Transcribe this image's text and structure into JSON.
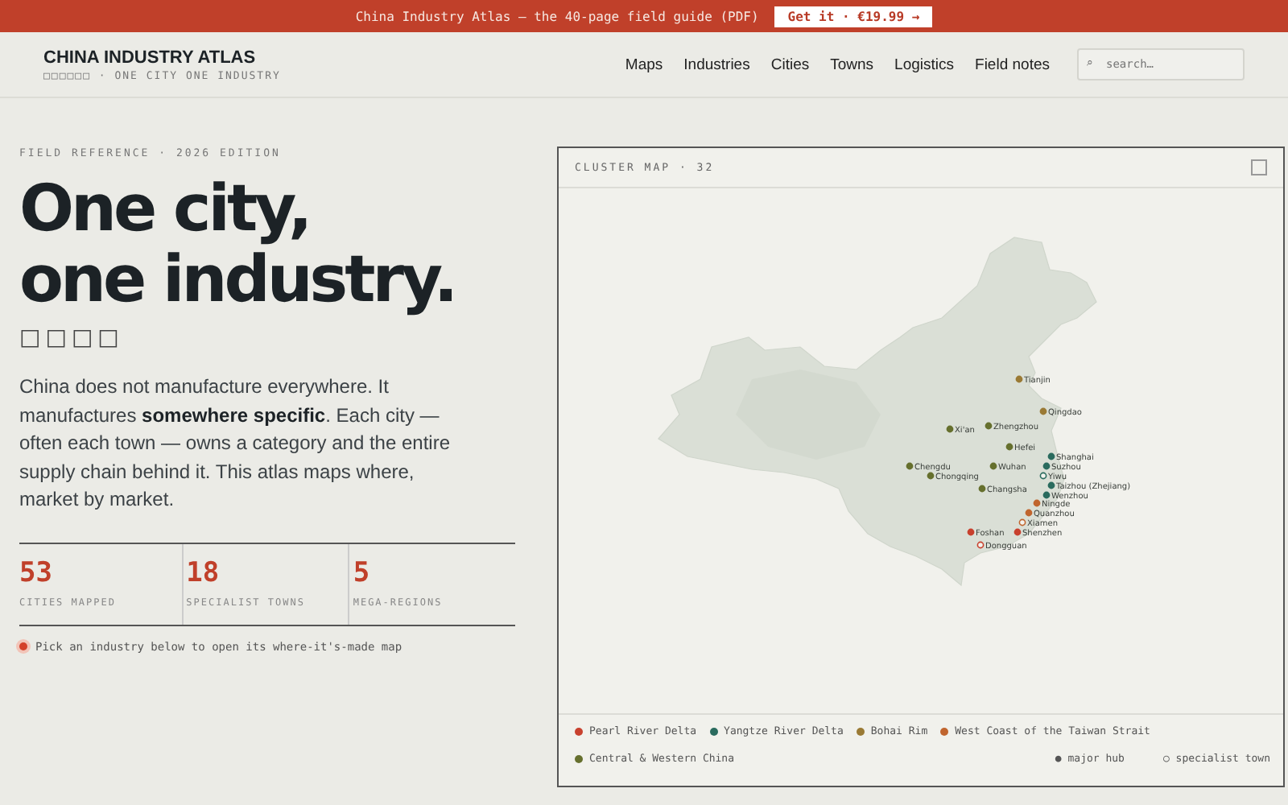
{
  "banner": {
    "text": "China Industry Atlas — the 40-page field guide (PDF)",
    "button": "Get it · €19.99 →"
  },
  "header": {
    "brand": "CHINA INDUSTRY ATLAS",
    "tagline": "□□□□□□ · ONE CITY ONE INDUSTRY",
    "nav": [
      "Maps",
      "Industries",
      "Cities",
      "Towns",
      "Logistics",
      "Field notes"
    ],
    "search": {
      "icon": "⌕",
      "placeholder": "search…"
    }
  },
  "hero": {
    "eyebrow": "FIELD REFERENCE · 2026 EDITION",
    "title_lines": [
      "One city,",
      "one industry."
    ],
    "title_cn": "□□□□",
    "intro": "China does not manufacture everywhere. It manufactures **somewhere specific**. Each city — often each town — owns a category and the entire supply chain behind it. This atlas maps where, market by market.",
    "stats": [
      {
        "value": "53",
        "label": "CITIES MAPPED"
      },
      {
        "value": "18",
        "label": "SPECIALIST TOWNS"
      },
      {
        "value": "5",
        "label": "MEGA-REGIONS"
      }
    ],
    "hint": "Pick an industry below to open its where-it's-made map"
  },
  "map": {
    "title": "CLUSTER MAP · 32",
    "regions": [
      {
        "name": "Pearl River Delta",
        "color": "#c8412e",
        "cities": [
          {
            "name": "Shenzhen",
            "kind": "hub"
          },
          {
            "name": "Foshan",
            "kind": "hub"
          },
          {
            "name": "Dongguan",
            "kind": "town"
          }
        ]
      },
      {
        "name": "Yangtze River Delta",
        "color": "#2a6b5e",
        "cities": [
          {
            "name": "Shanghai",
            "kind": "hub"
          },
          {
            "name": "Suzhou",
            "kind": "hub"
          },
          {
            "name": "Yiwu",
            "kind": "town"
          },
          {
            "name": "Taizhou (Zhejiang)",
            "kind": "hub"
          },
          {
            "name": "Wenzhou",
            "kind": "hub"
          }
        ]
      },
      {
        "name": "Bohai Rim",
        "color": "#9a7a35",
        "cities": [
          {
            "name": "Tianjin",
            "kind": "hub"
          },
          {
            "name": "Qingdao",
            "kind": "hub"
          }
        ]
      },
      {
        "name": "West Coast of the Taiwan Strait",
        "color": "#c0652e",
        "cities": [
          {
            "name": "Ningde",
            "kind": "hub"
          },
          {
            "name": "Quanzhou",
            "kind": "hub"
          },
          {
            "name": "Xiamen",
            "kind": "town"
          }
        ]
      },
      {
        "name": "Central & Western China",
        "color": "#66702e",
        "cities": [
          {
            "name": "Zhengzhou",
            "kind": "hub"
          },
          {
            "name": "Xi'an",
            "kind": "hub"
          },
          {
            "name": "Hefei",
            "kind": "hub"
          },
          {
            "name": "Chengdu",
            "kind": "hub"
          },
          {
            "name": "Chongqing",
            "kind": "hub"
          },
          {
            "name": "Wuhan",
            "kind": "hub"
          },
          {
            "name": "Changsha",
            "kind": "hub"
          }
        ]
      }
    ],
    "legend_keys": [
      {
        "symbol": "●",
        "text": "major hub"
      },
      {
        "symbol": "○",
        "text": "specialist town"
      }
    ]
  }
}
